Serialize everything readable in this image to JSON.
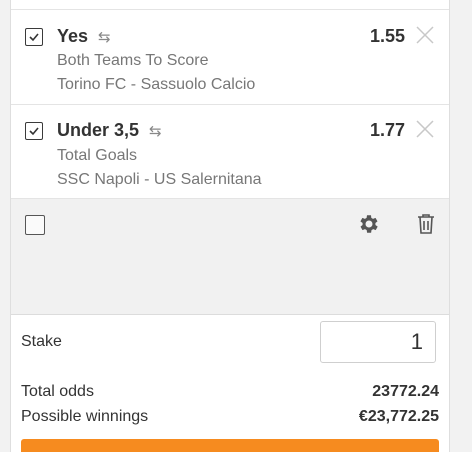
{
  "bets": [
    {
      "selection": "Yes",
      "odds": "1.55",
      "market": "Both Teams To Score",
      "event": "Torino FC - Sassuolo Calcio"
    },
    {
      "selection": "Under 3,5",
      "odds": "1.77",
      "market": "Total Goals",
      "event": "SSC Napoli - US Salernitana"
    }
  ],
  "footer": {
    "stake_label": "Stake",
    "stake_value": "1",
    "total_odds_label": "Total odds",
    "total_odds_value": "23772.24",
    "winnings_label": "Possible winnings",
    "winnings_value": "€23,772.25"
  },
  "icons": {
    "swap": "swap-arrows-icon",
    "close": "close-icon",
    "settings": "gear-icon",
    "delete": "trash-icon"
  },
  "colors": {
    "accent": "#f68b1f",
    "text": "#333333",
    "muted": "#777777"
  }
}
